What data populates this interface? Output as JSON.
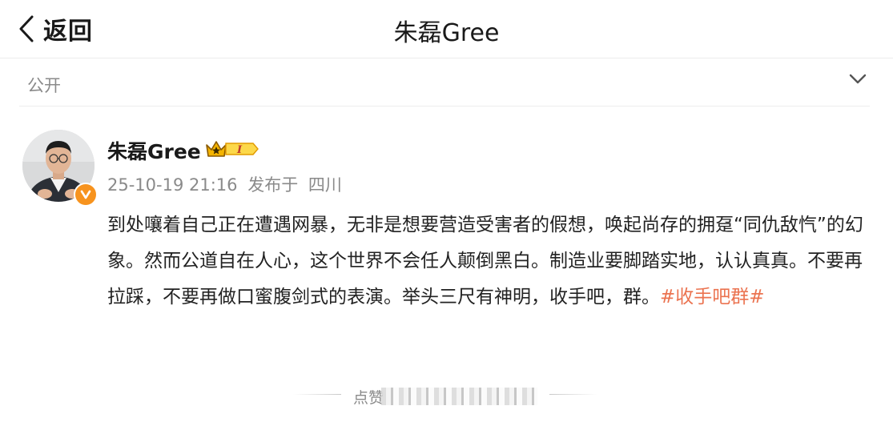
{
  "header": {
    "back_label": "返回",
    "title": "朱磊Gree"
  },
  "visibility": {
    "label": "公开",
    "icon": "chevron-down-icon"
  },
  "post": {
    "author": "朱磊Gree",
    "member_level": "I",
    "timestamp": "25-10-19 21:16",
    "location_prefix": "发布于",
    "location": "四川",
    "text": "到处嚷着自己正在遭遇网暴，无非是想要营造受害者的假想，唤起尚存的拥趸“同仇敌忾”的幻象。然而公道自在人心，这个世界不会任人颠倒黑白。制造业要脚踏实地，认认真真。不要再拉踩，不要再做口蜜腹剑式的表演。举头三尺有神明，收手吧，群。",
    "hashtag": "#收手吧群#"
  },
  "like_bar": {
    "label": "点赞"
  },
  "colors": {
    "hashtag": "#eb7350",
    "verified_badge": "#f7931e",
    "member_badge": "#f5b400"
  }
}
